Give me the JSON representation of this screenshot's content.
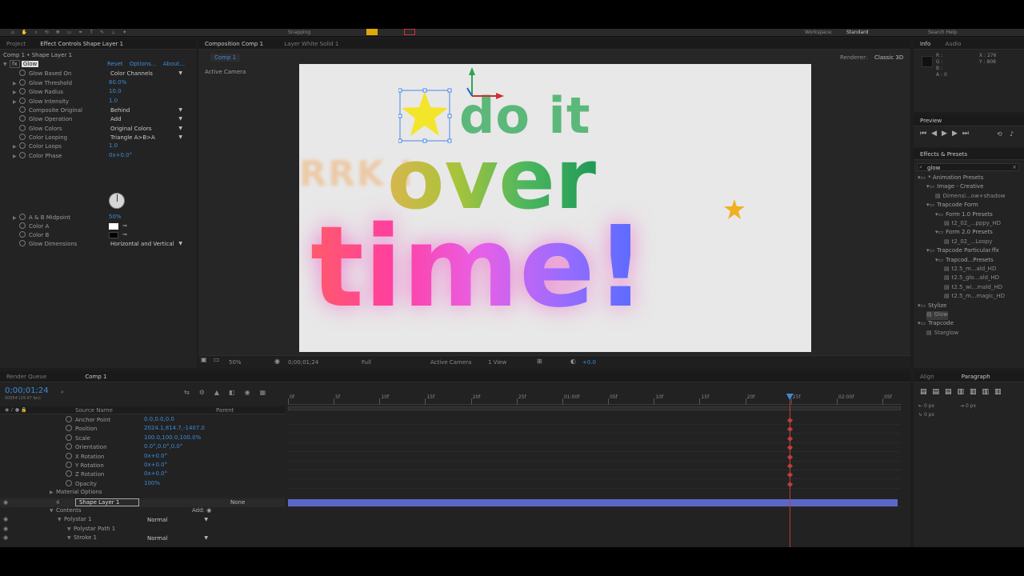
{
  "toolbar": {
    "snapping": "Snapping",
    "workspace_label": "Workspace:",
    "workspace_value": "Standard",
    "search_help": "Search Help"
  },
  "project_panel": {
    "tabs": [
      "Project",
      "Effect Controls Shape Layer 1"
    ],
    "subtitle": "Comp 1 • Shape Layer 1"
  },
  "effect": {
    "name": "Glow",
    "links": [
      "Reset",
      "Options...",
      "About..."
    ],
    "props": [
      {
        "label": "Glow Based On",
        "value": "Color Channels",
        "kind": "dropdown"
      },
      {
        "label": "Glow Threshold",
        "value": "60.0%",
        "kind": "value"
      },
      {
        "label": "Glow Radius",
        "value": "10.0",
        "kind": "value"
      },
      {
        "label": "Glow Intensity",
        "value": "1.0",
        "kind": "value"
      },
      {
        "label": "Composite Original",
        "value": "Behind",
        "kind": "dropdown"
      },
      {
        "label": "Glow Operation",
        "value": "Add",
        "kind": "dropdown"
      },
      {
        "label": "Glow Colors",
        "value": "Original Colors",
        "kind": "dropdown"
      },
      {
        "label": "Color Looping",
        "value": "Triangle A>B>A",
        "kind": "dropdown"
      },
      {
        "label": "Color Loops",
        "value": "1.0",
        "kind": "value"
      },
      {
        "label": "Color Phase",
        "value": "0x+0.0°",
        "kind": "value"
      }
    ],
    "midpoint": {
      "label": "A & B Midpoint",
      "value": "50%"
    },
    "color_a": "Color A",
    "color_b": "Color B",
    "dims": {
      "label": "Glow Dimensions",
      "value": "Horizontal and Vertical"
    }
  },
  "comp_panel": {
    "tabs": [
      "Composition Comp 1",
      "Layer White Solid 1"
    ],
    "comp_tab": "Comp 1",
    "renderer_label": "Renderer:",
    "renderer": "Classic 3D",
    "camera_label": "Active Camera"
  },
  "artwork": {
    "line1": "do it",
    "line2": "over",
    "line3": "time!",
    "ghost": "RRK I"
  },
  "viewer_bar": {
    "zoom": "50%",
    "timecode": "0;00;01;24",
    "resolution": "Full",
    "camera": "Active Camera",
    "views": "1 View",
    "exposure": "+0.0"
  },
  "info_panel": {
    "tabs": [
      "Info",
      "Audio"
    ],
    "r": "R :",
    "g": "G :",
    "b": "B :",
    "a": "A : 0",
    "x": "X : 276",
    "y": "Y : 808"
  },
  "preview_panel": {
    "title": "Preview"
  },
  "effects_panel": {
    "title": "Effects & Presets",
    "search": "glow",
    "tree": [
      {
        "label": "* Animation Presets",
        "depth": 0,
        "type": "folder"
      },
      {
        "label": "Image - Creative",
        "depth": 1,
        "type": "folder"
      },
      {
        "label": "Dimensi...ow+shadow",
        "depth": 2,
        "type": "file"
      },
      {
        "label": "Trapcode Form",
        "depth": 1,
        "type": "folder"
      },
      {
        "label": "Form 1.0 Presets",
        "depth": 2,
        "type": "folder"
      },
      {
        "label": "t2_02_...pppy_HD",
        "depth": 3,
        "type": "file"
      },
      {
        "label": "Form 2.0 Presets",
        "depth": 2,
        "type": "folder"
      },
      {
        "label": "t2_02_...Loopy",
        "depth": 3,
        "type": "file"
      },
      {
        "label": "Trapcode Particular.ffx",
        "depth": 1,
        "type": "folder"
      },
      {
        "label": "Trapcod...Presets",
        "depth": 2,
        "type": "folder"
      },
      {
        "label": "t2.5_m...ald_HD",
        "depth": 3,
        "type": "file"
      },
      {
        "label": "t2.5_glo...ald_HD",
        "depth": 3,
        "type": "file"
      },
      {
        "label": "t2.5_wi...mald_HD",
        "depth": 3,
        "type": "file"
      },
      {
        "label": "t2.5_m...magic_HD",
        "depth": 3,
        "type": "file"
      },
      {
        "label": "Stylize",
        "depth": 0,
        "type": "folder"
      },
      {
        "label": "Glow",
        "depth": 1,
        "type": "file",
        "selected": true
      },
      {
        "label": "Trapcode",
        "depth": 0,
        "type": "folder"
      },
      {
        "label": "Starglow",
        "depth": 1,
        "type": "file"
      }
    ]
  },
  "timeline": {
    "tabs": [
      "Render Queue",
      "Comp 1"
    ],
    "timecode": "0;00;01;24",
    "subtime": "00054 (29.97 fps)",
    "col_source": "Source Name",
    "col_parent": "Parent",
    "ruler": [
      "0f",
      "5f",
      "10f",
      "15f",
      "20f",
      "25f",
      "01:00f",
      "05f",
      "10f",
      "15f",
      "20f",
      "25f",
      "02:00f",
      "05f"
    ],
    "props": [
      {
        "label": "Anchor Point",
        "value": "0.0,0.0,0.0"
      },
      {
        "label": "Position",
        "value": "2024.1,814.7,-1407.0"
      },
      {
        "label": "Scale",
        "value": "100.0,100.0,100.0%"
      },
      {
        "label": "Orientation",
        "value": "0.0°,0.0°,0.0°"
      },
      {
        "label": "X Rotation",
        "value": "0x+0.0°"
      },
      {
        "label": "Y Rotation",
        "value": "0x+0.0°"
      },
      {
        "label": "Z Rotation",
        "value": "0x+0.0°"
      },
      {
        "label": "Opacity",
        "value": "100%"
      }
    ],
    "material": "Material Options",
    "layer": {
      "num": "4",
      "name": "Shape Layer 1",
      "parent": "None"
    },
    "contents": "Contents",
    "add": "Add:",
    "polystar": {
      "label": "Polystar 1",
      "mode": "Normal"
    },
    "polystar_path": "Polystar Path 1",
    "stroke": {
      "label": "Stroke 1",
      "mode": "Normal"
    },
    "playhead_frame": 54
  },
  "align_panel": {
    "tabs": [
      "Align",
      "Paragraph"
    ],
    "v1": "0 px",
    "v2": "0 px",
    "v3": "0 px"
  },
  "colors": {
    "accent": "#3d8bd8",
    "keyframe": "#c23b3b",
    "layer_bar": "#5b67c7"
  }
}
